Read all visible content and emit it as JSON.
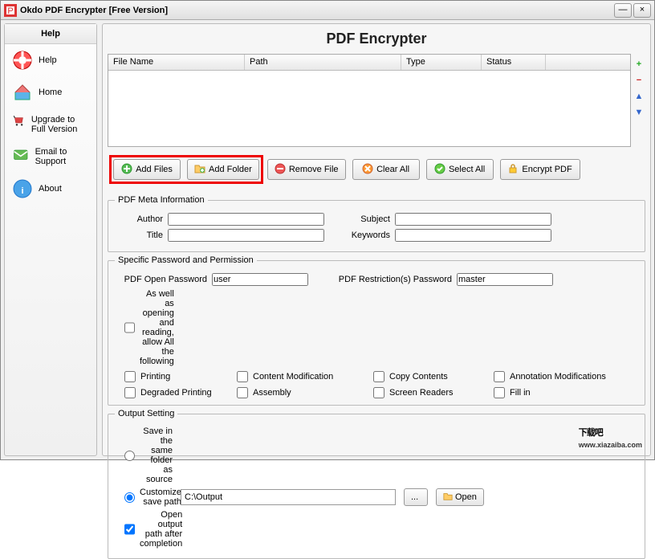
{
  "window": {
    "title": "Okdo PDF Encrypter [Free Version]"
  },
  "sidebar": {
    "header": "Help",
    "items": [
      {
        "label": "Help"
      },
      {
        "label": "Home"
      },
      {
        "label": "Upgrade to Full Version"
      },
      {
        "label": "Email to Support"
      },
      {
        "label": "About"
      }
    ]
  },
  "main": {
    "title": "PDF Encrypter",
    "columns": {
      "filename": "File Name",
      "path": "Path",
      "type": "Type",
      "status": "Status"
    }
  },
  "toolbar": {
    "add_files": "Add Files",
    "add_folder": "Add Folder",
    "remove_file": "Remove File",
    "clear_all": "Clear All",
    "select_all": "Select All",
    "encrypt": "Encrypt PDF"
  },
  "meta": {
    "legend": "PDF Meta Information",
    "author_label": "Author",
    "author": "",
    "subject_label": "Subject",
    "subject": "",
    "title_label": "Title",
    "title": "",
    "keywords_label": "Keywords",
    "keywords": ""
  },
  "perm": {
    "legend": "Specific Password and Permission",
    "open_label": "PDF Open Password",
    "open_value": "user",
    "restrict_label": "PDF Restriction(s) Password",
    "restrict_value": "master",
    "allow_all": "As well as opening and reading, allow All the following",
    "printing": "Printing",
    "content_mod": "Content Modification",
    "copy": "Copy Contents",
    "annot": "Annotation Modifications",
    "degraded": "Degraded Printing",
    "assembly": "Assembly",
    "screen": "Screen Readers",
    "fillin": "Fill in"
  },
  "output": {
    "legend": "Output Setting",
    "same_folder": "Save in the same folder as source",
    "customize": "Customize save path",
    "path": "C:\\Output",
    "browse": "...",
    "open": "Open",
    "open_after": "Open output path after completion"
  },
  "watermark": {
    "text": "下载吧",
    "url": "www.xiazaiba.com"
  }
}
